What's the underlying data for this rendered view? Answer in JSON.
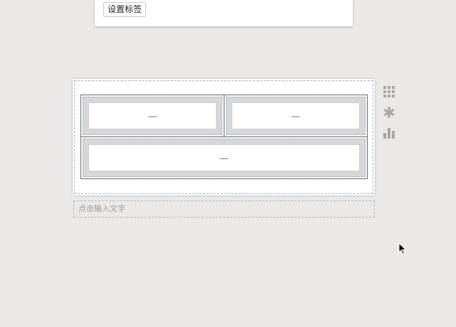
{
  "toolbar": {
    "set_label_button": "设置标签"
  },
  "table": {
    "rows": [
      [
        "—",
        "—"
      ],
      [
        "—"
      ]
    ]
  },
  "caption": {
    "placeholder": "点击输入文字"
  },
  "side_tools": [
    {
      "icon": "grid-icon"
    },
    {
      "icon": "asterisk-icon"
    },
    {
      "icon": "bar-chart-icon"
    }
  ],
  "colors": {
    "background": "#ebe9e7",
    "grid_border": "#5f666d",
    "cell_fill": "#d7d7d7",
    "tool_icon": "#a7a7a7",
    "selection_outline": "#8fb3d6"
  }
}
